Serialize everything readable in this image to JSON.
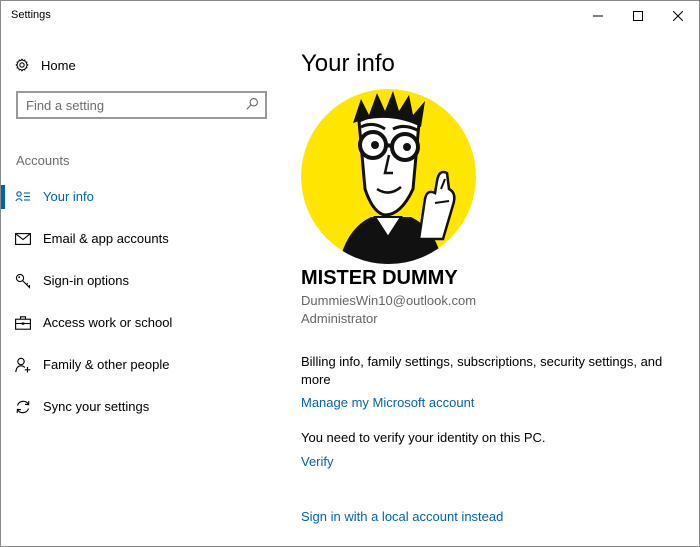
{
  "window": {
    "title": "Settings"
  },
  "sidebar": {
    "home_label": "Home",
    "search_placeholder": "Find a setting",
    "section_label": "Accounts",
    "items": [
      {
        "label": "Your info",
        "icon": "person-card-icon",
        "selected": true
      },
      {
        "label": "Email & app accounts",
        "icon": "envelope-icon",
        "selected": false
      },
      {
        "label": "Sign-in options",
        "icon": "key-icon",
        "selected": false
      },
      {
        "label": "Access work or school",
        "icon": "briefcase-icon",
        "selected": false
      },
      {
        "label": "Family & other people",
        "icon": "person-add-icon",
        "selected": false
      },
      {
        "label": "Sync your settings",
        "icon": "sync-icon",
        "selected": false
      }
    ]
  },
  "main": {
    "title": "Your info",
    "user": {
      "name": "MISTER DUMMY",
      "email": "DummiesWin10@outlook.com",
      "role": "Administrator"
    },
    "billing_text": "Billing info, family settings, subscriptions, security settings, and more",
    "manage_link": "Manage my Microsoft account",
    "verify_text": "You need to verify your identity on this PC.",
    "verify_link": "Verify",
    "local_account_link": "Sign in with a local account instead"
  },
  "colors": {
    "accent": "#0063b1",
    "avatar_background": "#ffe600"
  }
}
